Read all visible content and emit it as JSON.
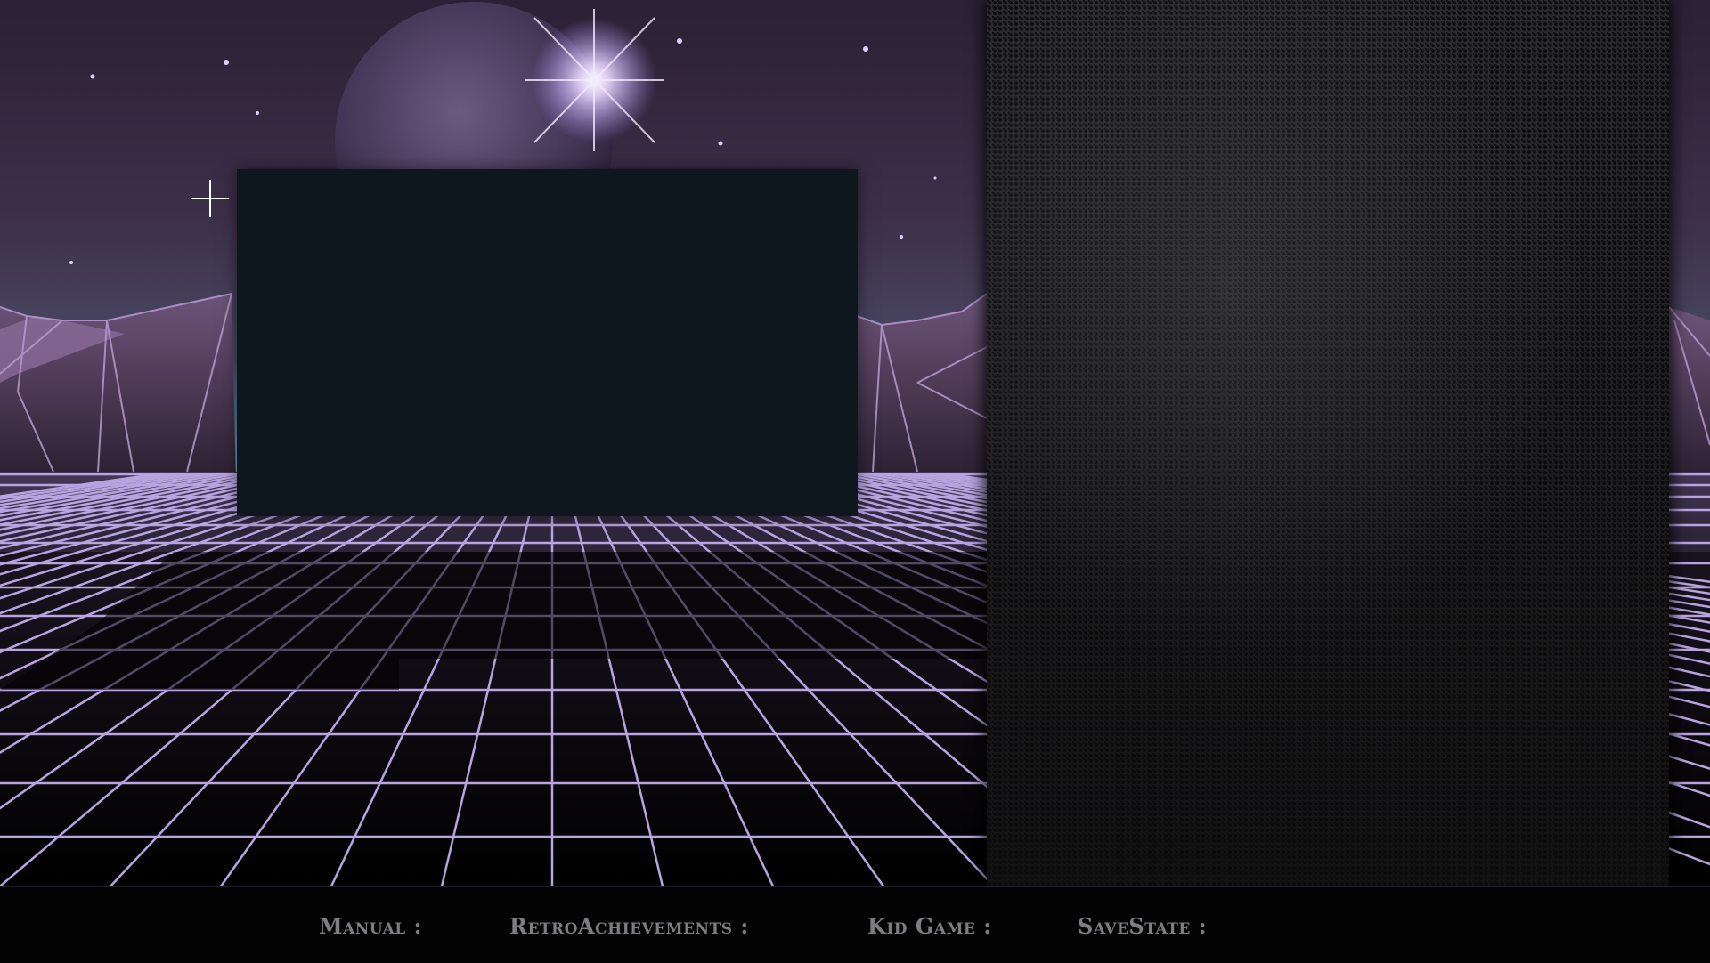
{
  "status_bar": {
    "manual": "Manual :",
    "retroachievements": "RetroAchievements :",
    "kid_game": "Kid Game :",
    "savestate": "SaveState :"
  },
  "theme": {
    "sky_top": "#2b2035",
    "grid_line": "#b7a4e0",
    "preview_bg": "#0f171e",
    "panel_bg": "#202022",
    "status_text": "#7d7d82"
  }
}
